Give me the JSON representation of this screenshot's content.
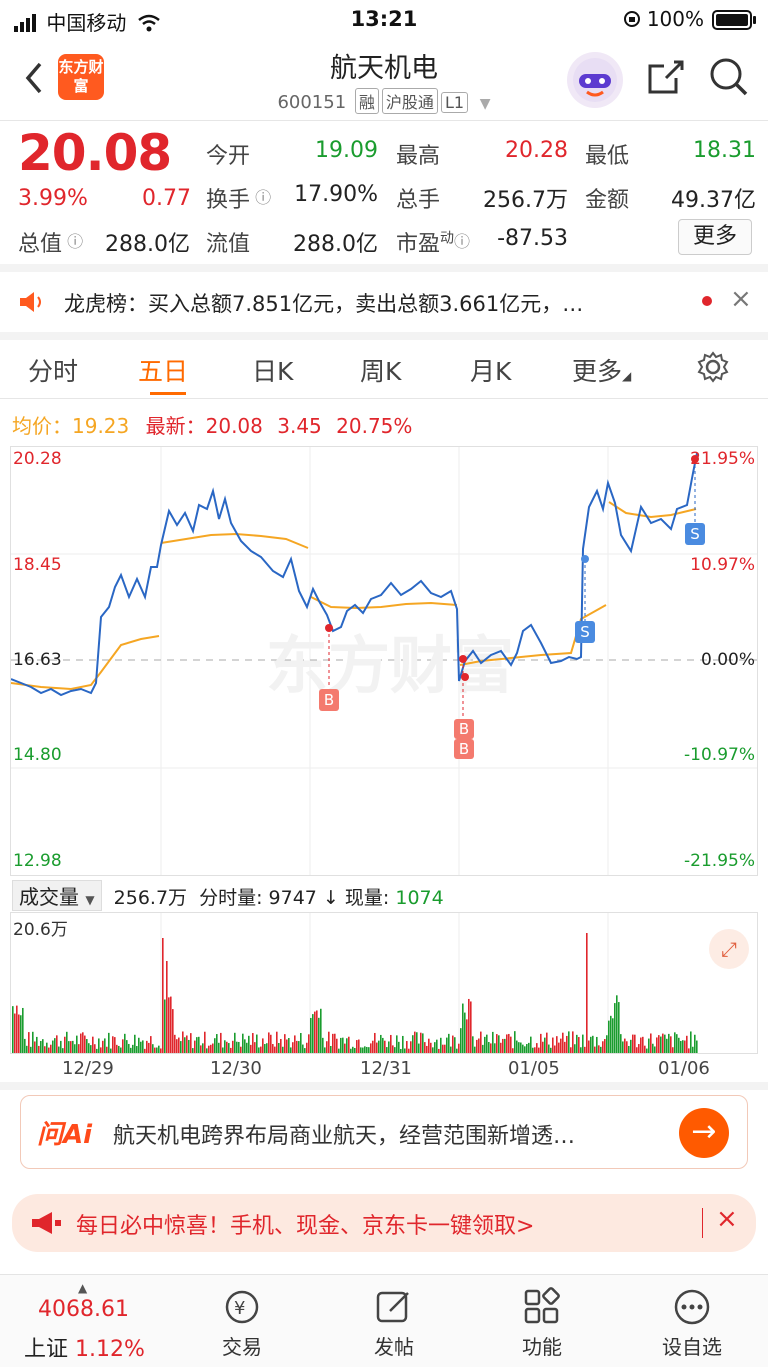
{
  "status": {
    "carrier": "中国移动",
    "time": "13:21",
    "battery": "100%"
  },
  "header": {
    "back": "‹",
    "logo": "东方财富",
    "title": "航天机电",
    "code": "600151",
    "tags": [
      "融",
      "沪股通",
      "L1"
    ]
  },
  "quote": {
    "price": "20.08",
    "pct": "3.99%",
    "chg": "0.77",
    "open_label": "今开",
    "open": "19.09",
    "high_label": "最高",
    "high": "20.28",
    "low_label": "最低",
    "low": "18.31",
    "turnover_label": "换手",
    "turnover": "17.90%",
    "vol_label": "总手",
    "vol": "256.7万",
    "amount_label": "金额",
    "amount": "49.37亿",
    "mcap_label": "总值",
    "mcap": "288.0亿",
    "float_label": "流值",
    "float": "288.0亿",
    "pe_label": "市盈",
    "pe_sup": "动",
    "pe": "-87.53",
    "more": "更多"
  },
  "notice": {
    "text": "龙虎榜：买入总额7.851亿元，卖出总额3.661亿元，…",
    "close": "×"
  },
  "tabs": [
    "分时",
    "五日",
    "日K",
    "周K",
    "月K",
    "更多"
  ],
  "legend": {
    "avg_label": "均价：",
    "avg": "19.23",
    "latest_label": "最新：",
    "latest": "20.08",
    "chg": "3.45",
    "pct": "20.75%"
  },
  "chart": {
    "y_left": [
      "20.28",
      "18.45",
      "16.63",
      "14.80",
      "12.98"
    ],
    "y_right": [
      "21.95%",
      "10.97%",
      "0.00%",
      "-10.97%",
      "-21.95%"
    ],
    "markers": [
      "B",
      "B",
      "B",
      "S",
      "S"
    ],
    "watermark": "东方财富"
  },
  "volume": {
    "selector": "成交量",
    "total": "256.7万",
    "tick_label": "分时量:",
    "tick": "9747",
    "arrow": "↓",
    "now_label": "现量:",
    "now": "1074",
    "max": "20.6万"
  },
  "x_labels": [
    "12/29",
    "12/30",
    "12/31",
    "01/05",
    "01/06"
  ],
  "ai": {
    "brand": "问Ai",
    "text": "航天机电跨界布局商业航天，经营范围新增透…"
  },
  "promo": {
    "text": "每日必中惊喜！手机、现金、京东卡一键领取>",
    "close": "×"
  },
  "bottom": {
    "index_value": "4068.61",
    "index_name": "上证",
    "index_pct": "1.12%",
    "items": [
      "交易",
      "发帖",
      "功能",
      "设自选"
    ]
  },
  "colors": {
    "up": "#e0262c",
    "down": "#1a9c2e",
    "price_line": "#2a67c4",
    "avg_line": "#f5a623",
    "accent": "#ff6a00"
  }
}
